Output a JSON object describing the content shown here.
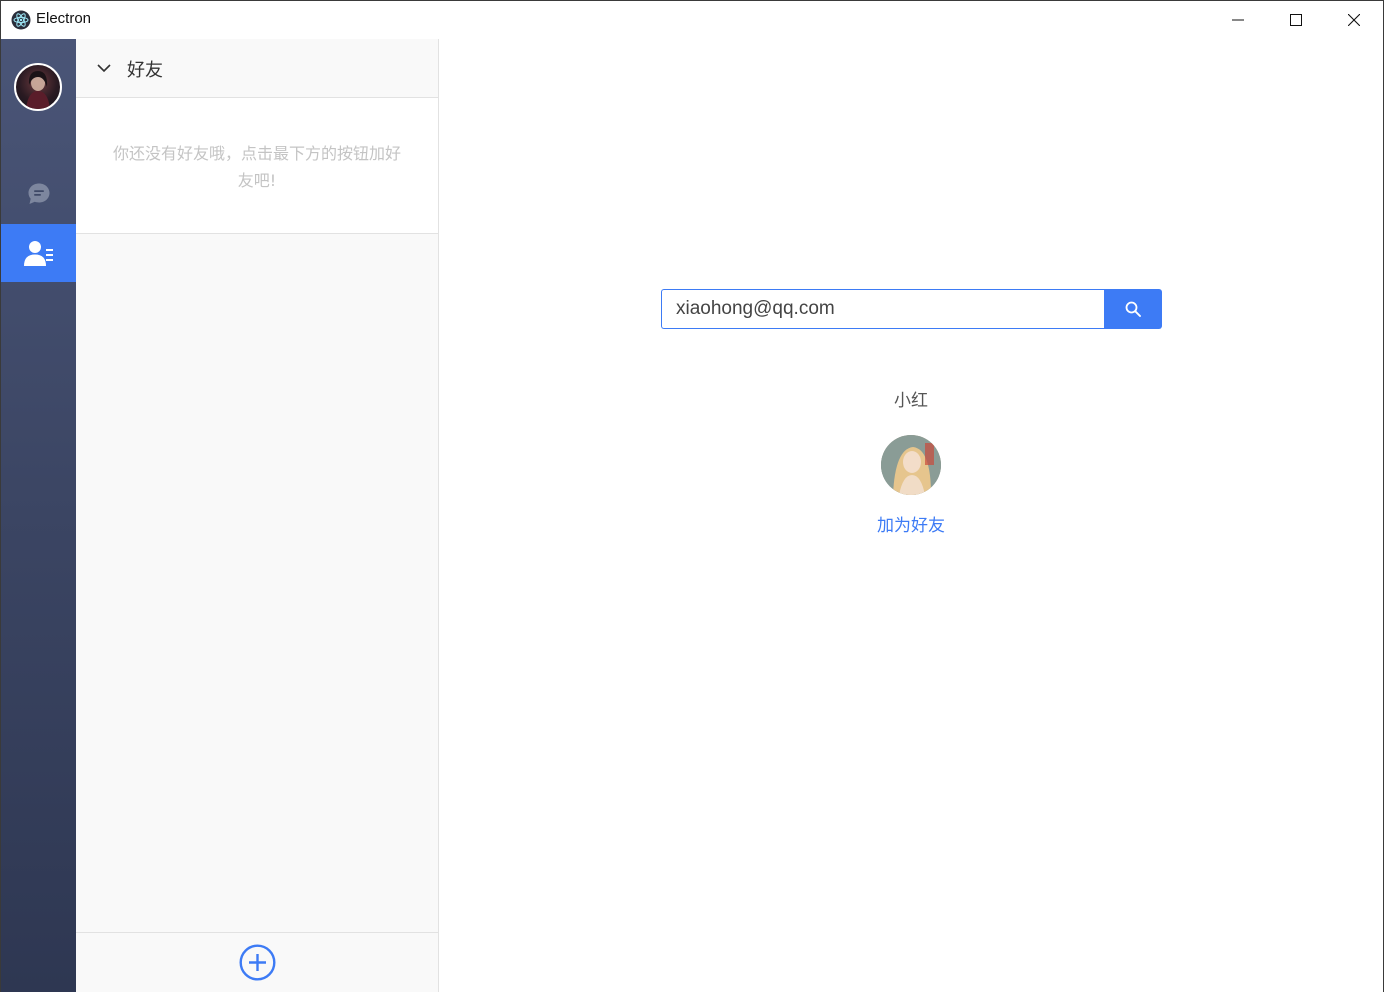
{
  "window": {
    "title": "Electron",
    "icon": "electron-atom-icon"
  },
  "nav": {
    "items": [
      {
        "icon": "chat-bubble-icon",
        "active": false
      },
      {
        "icon": "contacts-icon",
        "active": true
      }
    ],
    "active_color": "#3d7bf5"
  },
  "friends_panel": {
    "group_title": "好友",
    "empty_message": "你还没有好友哦，点击最下方的按钮加好友吧!",
    "add_icon": "plus-circle-icon"
  },
  "search": {
    "value": "xiaohong@qq.com",
    "button_icon": "search-icon"
  },
  "result": {
    "name": "小红",
    "action_label": "加为好友"
  },
  "colors": {
    "accent": "#3d7bf5",
    "nav_top": "#4a5577",
    "nav_bottom": "#2e3752"
  }
}
